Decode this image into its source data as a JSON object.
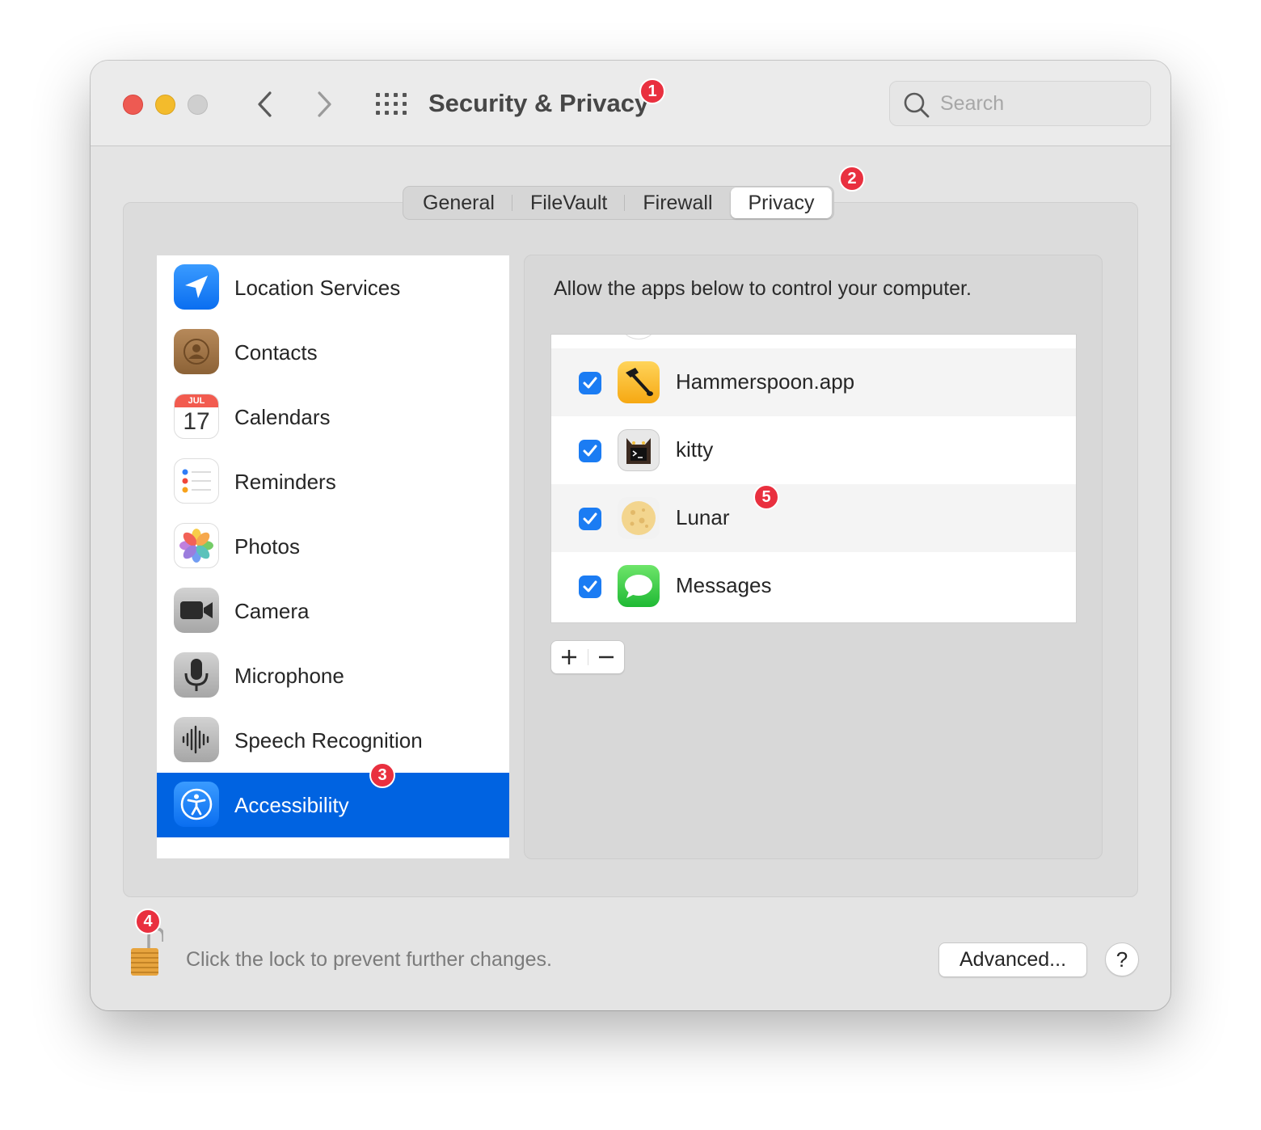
{
  "window": {
    "title": "Security & Privacy",
    "search_placeholder": "Search"
  },
  "tabs": [
    {
      "label": "General"
    },
    {
      "label": "FileVault"
    },
    {
      "label": "Firewall"
    },
    {
      "label": "Privacy",
      "active": true
    }
  ],
  "sidebar": {
    "items": [
      {
        "label": "Location Services",
        "icon": "location-arrow-icon"
      },
      {
        "label": "Contacts",
        "icon": "contacts-icon"
      },
      {
        "label": "Calendars",
        "icon": "calendar-icon",
        "month": "JUL",
        "day": "17"
      },
      {
        "label": "Reminders",
        "icon": "reminders-icon"
      },
      {
        "label": "Photos",
        "icon": "photos-icon"
      },
      {
        "label": "Camera",
        "icon": "camera-icon"
      },
      {
        "label": "Microphone",
        "icon": "microphone-icon"
      },
      {
        "label": "Speech Recognition",
        "icon": "waveform-icon"
      },
      {
        "label": "Accessibility",
        "icon": "accessibility-icon",
        "selected": true
      }
    ]
  },
  "content": {
    "description": "Allow the apps below to control your computer.",
    "apps": [
      {
        "name": "Hammerspoon.app",
        "checked": true,
        "icon": "hammerspoon-icon"
      },
      {
        "name": "kitty",
        "checked": true,
        "icon": "kitty-icon"
      },
      {
        "name": "Lunar",
        "checked": true,
        "icon": "lunar-icon"
      },
      {
        "name": "Messages",
        "checked": true,
        "icon": "messages-icon"
      }
    ],
    "add_label": "+",
    "remove_label": "—"
  },
  "footer": {
    "lock_text": "Click the lock to prevent further changes.",
    "advanced_label": "Advanced...",
    "help_label": "?"
  },
  "annotations": [
    "1",
    "2",
    "3",
    "4",
    "5"
  ],
  "colors": {
    "selection": "#0063e1",
    "checkbox": "#1b7cf3",
    "badge": "#e9303f"
  }
}
